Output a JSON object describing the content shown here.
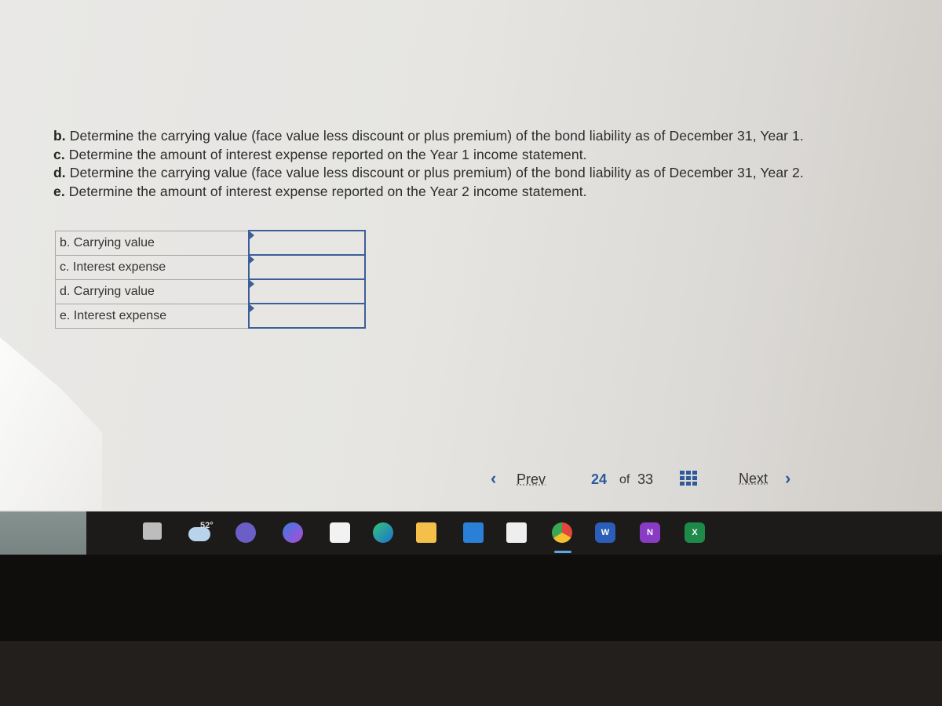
{
  "questions": [
    {
      "letter": "b.",
      "text": " Determine the carrying value (face value less discount or plus premium) of the bond liability as of December 31, Year 1."
    },
    {
      "letter": "c.",
      "text": " Determine the amount of interest expense reported on the Year 1 income statement."
    },
    {
      "letter": "d.",
      "text": " Determine the carrying value (face value less discount or plus premium) of the bond liability as of December 31, Year 2."
    },
    {
      "letter": "e.",
      "text": " Determine the amount of interest expense reported on the Year 2 income statement."
    }
  ],
  "answers": [
    {
      "label": "b. Carrying value",
      "value": ""
    },
    {
      "label": "c. Interest expense",
      "value": ""
    },
    {
      "label": "d. Carrying value",
      "value": ""
    },
    {
      "label": "e. Interest expense",
      "value": ""
    }
  ],
  "pagination": {
    "prev_label": "Prev",
    "next_label": "Next",
    "current": "24",
    "of_label": "of",
    "total": "33"
  },
  "taskbar": {
    "weather_temp": "52°",
    "apps": [
      "task-view",
      "weather",
      "teams-chat",
      "copilot",
      "microsoft-store",
      "edge",
      "file-explorer",
      "mail",
      "snipping-tool",
      "chrome",
      "word",
      "onenote",
      "excel"
    ],
    "word_letter": "W",
    "onenote_letter": "N",
    "excel_letter": "X"
  },
  "colors": {
    "accent": "#2e5a9a",
    "input_border": "#3c5f99"
  }
}
